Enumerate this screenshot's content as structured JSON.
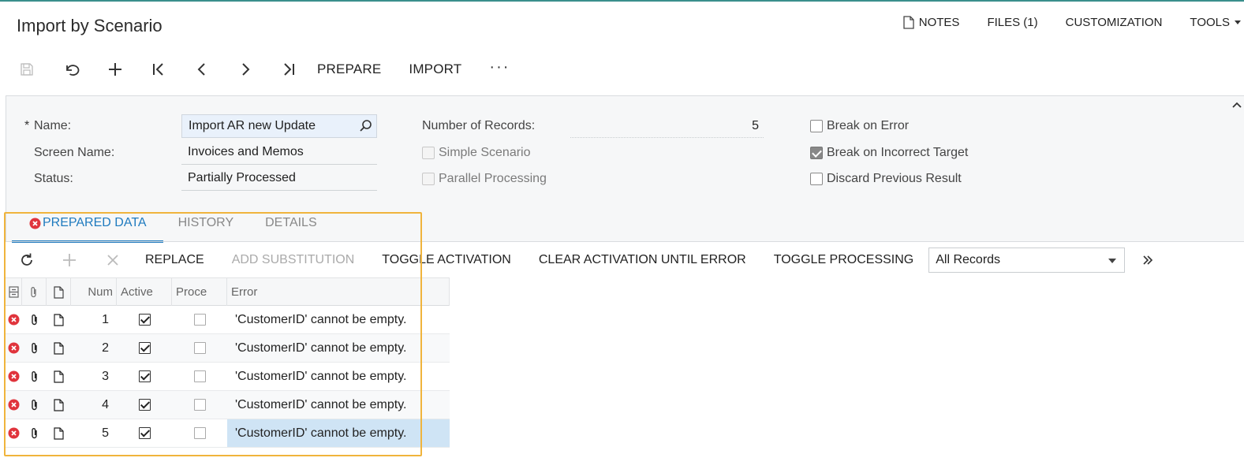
{
  "page": {
    "title": "Import by Scenario"
  },
  "top_menu": {
    "notes": "NOTES",
    "files": "FILES (1)",
    "customization": "CUSTOMIZATION",
    "tools": "TOOLS"
  },
  "toolbar": {
    "icons": [
      "save-icon",
      "undo-icon",
      "add-icon",
      "first-icon",
      "previous-icon",
      "next-icon",
      "last-icon"
    ],
    "prepare": "PREPARE",
    "import": "IMPORT",
    "more": "···"
  },
  "form": {
    "name_label": "Name:",
    "required_mark": "*",
    "name_value": "Import AR new Update",
    "screen_name_label": "Screen Name:",
    "screen_name_value": "Invoices and Memos",
    "status_label": "Status:",
    "status_value": "Partially Processed",
    "num_records_label": "Number of Records:",
    "num_records_value": "5",
    "simple_scenario": {
      "label": "Simple Scenario",
      "checked": false,
      "disabled": true
    },
    "parallel_processing": {
      "label": "Parallel Processing",
      "checked": false,
      "disabled": true
    },
    "break_on_error": {
      "label": "Break on Error",
      "checked": false
    },
    "break_on_incorrect_target": {
      "label": "Break on Incorrect Target",
      "checked": true
    },
    "discard_previous_result": {
      "label": "Discard Previous Result",
      "checked": false
    }
  },
  "tabs": [
    {
      "label": "PREPARED DATA",
      "active": true,
      "has_error": true
    },
    {
      "label": "HISTORY",
      "active": false
    },
    {
      "label": "DETAILS",
      "active": false
    }
  ],
  "grid_toolbar": {
    "replace": "REPLACE",
    "add_substitution": "ADD SUBSTITUTION",
    "toggle_activation": "TOGGLE ACTIVATION",
    "clear_activation": "CLEAR ACTIVATION UNTIL ERROR",
    "toggle_processing": "TOGGLE PROCESSING",
    "filter_value": "All Records"
  },
  "grid": {
    "columns": [
      "",
      "",
      "",
      "Num",
      "Active",
      "Proce",
      "Error"
    ],
    "rows": [
      {
        "num": "1",
        "active": true,
        "processed": false,
        "error": "'CustomerID' cannot be empty."
      },
      {
        "num": "2",
        "active": true,
        "processed": false,
        "error": "'CustomerID' cannot be empty."
      },
      {
        "num": "3",
        "active": true,
        "processed": false,
        "error": "'CustomerID' cannot be empty."
      },
      {
        "num": "4",
        "active": true,
        "processed": false,
        "error": "'CustomerID' cannot be empty."
      },
      {
        "num": "5",
        "active": true,
        "processed": false,
        "error": "'CustomerID' cannot be empty."
      }
    ]
  },
  "colors": {
    "accent": "#1f7bbf",
    "error": "#e0343c",
    "highlight": "#f0b43c",
    "selected_row": "#cfe4f5"
  }
}
